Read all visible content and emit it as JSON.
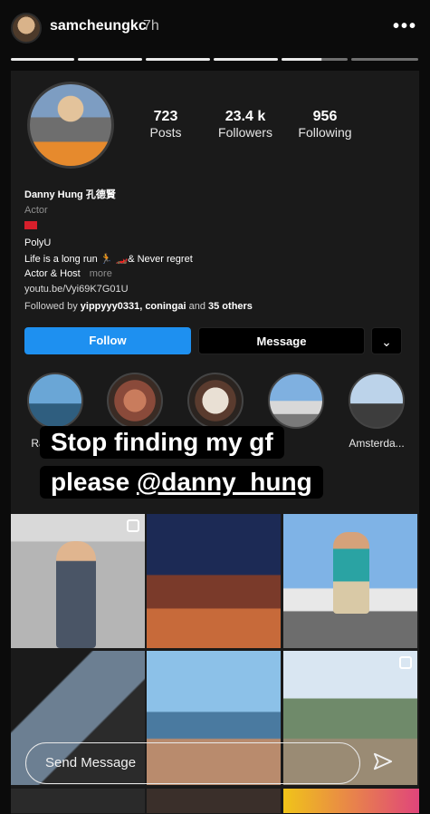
{
  "story": {
    "username": "samcheungkc",
    "time": "7h",
    "more_icon": "more-dots-icon",
    "segments_total": 6,
    "segments_watched": 4
  },
  "profile": {
    "stats": [
      {
        "value": "723",
        "label": "Posts"
      },
      {
        "value": "23.4 k",
        "label": "Followers"
      },
      {
        "value": "956",
        "label": "Following"
      }
    ],
    "name": "Danny Hung 孔德賢",
    "category": "Actor",
    "flag_icon": "hong-kong-flag-icon",
    "bio_lines": [
      "PolyU",
      "Life is a long run 🏃 🏎️& Never regret",
      "Actor & Host"
    ],
    "more": "more",
    "link": "youtu.be/Vyi69K7G01U",
    "followed_prefix": "Followed by ",
    "followed_names": "yippyyy0331, coningai",
    "followed_and": " and ",
    "followed_others": "35 others",
    "follow_label": "Follow",
    "message_label": "Message",
    "chevron": "⌄",
    "highlights": [
      {
        "label": "Ra"
      },
      {
        "label": ""
      },
      {
        "label": ""
      },
      {
        "label": ""
      },
      {
        "label": "Amsterda..."
      }
    ]
  },
  "overlay": {
    "line1": "Stop finding my gf",
    "line2_prefix": "please ",
    "line2_mention": "@danny_hung"
  },
  "reply": {
    "placeholder": "Send Message",
    "send_icon": "paper-plane-icon"
  },
  "colors": {
    "follow_blue": "#1e90f0",
    "background": "#0b0b0b",
    "card": "#1a1a1a"
  }
}
